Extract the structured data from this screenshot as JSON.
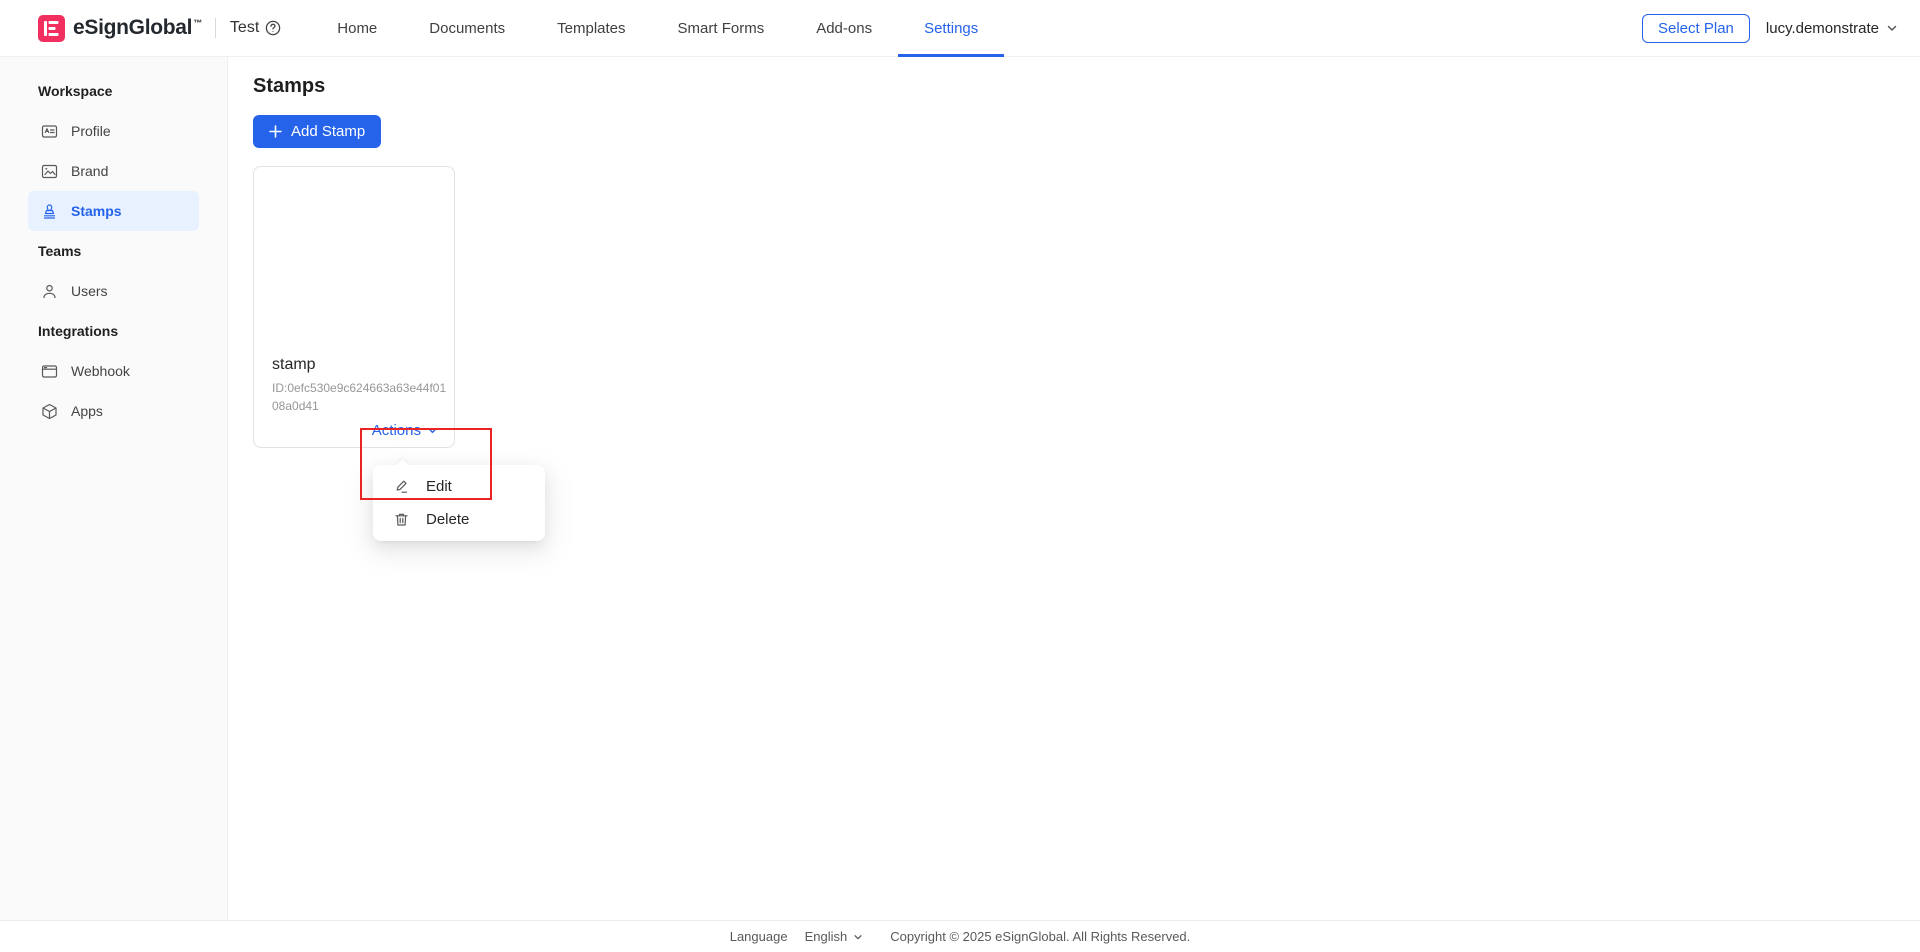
{
  "header": {
    "brand": {
      "name": "eSignGlobal",
      "tm": "™",
      "workspace": "Test"
    },
    "nav": [
      {
        "label": "Home",
        "active": false
      },
      {
        "label": "Documents",
        "active": false
      },
      {
        "label": "Templates",
        "active": false
      },
      {
        "label": "Smart Forms",
        "active": false
      },
      {
        "label": "Add-ons",
        "active": false
      },
      {
        "label": "Settings",
        "active": true
      }
    ],
    "select_plan": "Select Plan",
    "username": "lucy.demonstrate"
  },
  "sidebar": {
    "sections": [
      {
        "title": "Workspace",
        "items": [
          {
            "label": "Profile",
            "icon": "id-card-icon",
            "active": false
          },
          {
            "label": "Brand",
            "icon": "image-icon",
            "active": false
          },
          {
            "label": "Stamps",
            "icon": "stamp-icon",
            "active": true
          }
        ]
      },
      {
        "title": "Teams",
        "items": [
          {
            "label": "Users",
            "icon": "user-icon",
            "active": false
          }
        ]
      },
      {
        "title": "Integrations",
        "items": [
          {
            "label": "Webhook",
            "icon": "browser-window-icon",
            "active": false
          },
          {
            "label": "Apps",
            "icon": "cube-icon",
            "active": false
          }
        ]
      }
    ]
  },
  "main": {
    "page_title": "Stamps",
    "add_stamp_button": "Add Stamp",
    "card": {
      "name": "stamp",
      "stamp_id": "ID:0efc530e9c624663a63e44f0108a0d41",
      "actions_label": "Actions"
    },
    "actions_menu": {
      "items": [
        {
          "label": "Edit",
          "icon": "edit-icon"
        },
        {
          "label": "Delete",
          "icon": "trash-icon"
        }
      ]
    }
  },
  "footer": {
    "language_label": "Language",
    "language_value": "English",
    "copyright": "Copyright © 2025 eSignGlobal. All Rights Reserved."
  },
  "colors": {
    "accent_blue": "#2563eb",
    "brand_pink": "#f1305f",
    "annotation_red": "#ea2323",
    "active_item_bg": "#e8f1ff",
    "sidebar_bg": "#fafafa"
  }
}
